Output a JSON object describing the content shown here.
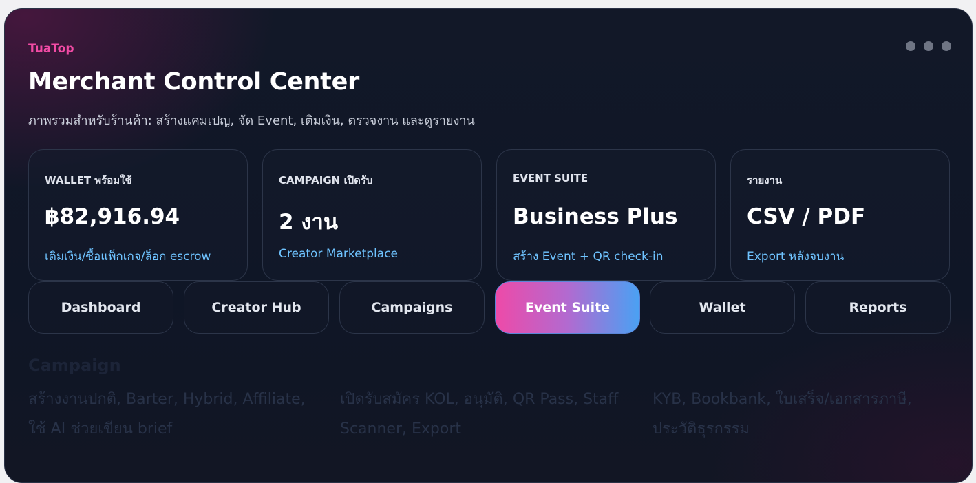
{
  "brand": "TuaTop",
  "title": "Merchant Control Center",
  "subtitle": "ภาพรวมสำหรับร้านค้า: สร้างแคมเปญ, จัด Event, เติมเงิน, ตรวจงาน และดูรายงาน",
  "stats": [
    {
      "label": "WALLET พร้อมใช้",
      "value": "฿82,916.94",
      "sub": "เติมเงิน/ซื้อแพ็กเกจ/ล็อก escrow"
    },
    {
      "label": "CAMPAIGN เปิดรับ",
      "value": "2 งาน",
      "sub": "Creator Marketplace"
    },
    {
      "label": "EVENT SUITE",
      "value": "Business Plus",
      "sub": "สร้าง Event + QR check-in"
    },
    {
      "label": "รายงาน",
      "value": "CSV / PDF",
      "sub": "Export หลังจบงาน"
    }
  ],
  "tabs": [
    {
      "label": "Dashboard"
    },
    {
      "label": "Creator Hub"
    },
    {
      "label": "Campaigns"
    },
    {
      "label": "Event Suite",
      "active": true
    },
    {
      "label": "Wallet"
    },
    {
      "label": "Reports"
    }
  ],
  "section": {
    "title": "Campaign",
    "features": [
      "สร้างงานปกติ, Barter, Hybrid, Affiliate, ใช้ AI ช่วยเขียน brief",
      "เปิดรับสมัคร KOL, อนุมัติ, QR Pass, Staff Scanner, Export",
      "KYB, Bookbank, ใบเสร็จ/เอกสารภาษี, ประวัติธุรกรรม"
    ]
  },
  "colors": {
    "brand_pink": "#f24ba5",
    "link_blue": "#6fc3ff",
    "active_gradient_start": "#ee4aa8",
    "active_gradient_end": "#4aa1f3"
  }
}
